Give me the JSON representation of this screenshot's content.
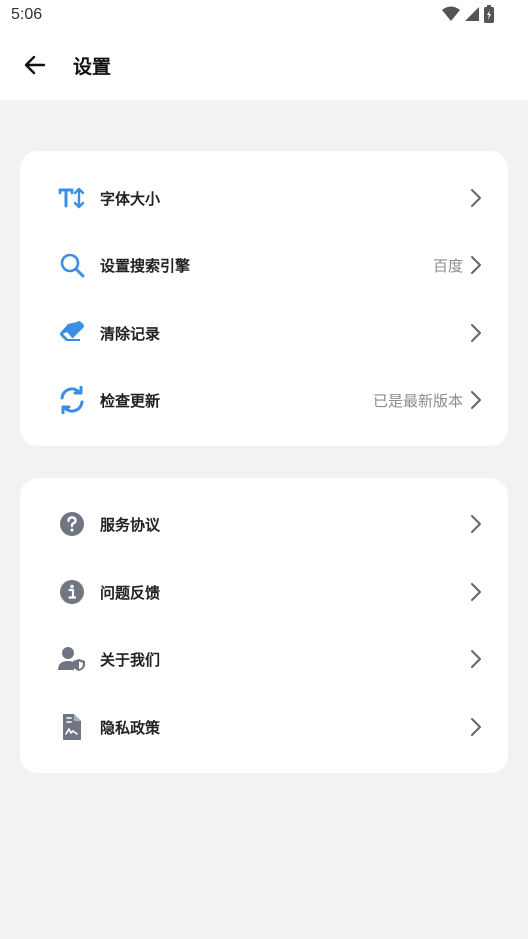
{
  "status_bar": {
    "time": "5:06",
    "icons": [
      "wifi-icon",
      "cell-signal-icon",
      "battery-icon"
    ]
  },
  "app_bar": {
    "title": "设置",
    "back_icon": "arrow-left-icon"
  },
  "colors": {
    "accent": "#3b8fe3",
    "icon_gray": "#6f7582",
    "background": "#f1f2f4"
  },
  "group1": {
    "items": [
      {
        "label": "字体大小",
        "value": "",
        "icon": "font-size-icon"
      },
      {
        "label": "设置搜索引擎",
        "value": "百度",
        "icon": "search-icon"
      },
      {
        "label": "清除记录",
        "value": "",
        "icon": "eraser-icon"
      },
      {
        "label": "检查更新",
        "value": "已是最新版本",
        "icon": "refresh-icon"
      }
    ]
  },
  "group2": {
    "items": [
      {
        "label": "服务协议",
        "value": "",
        "icon": "question-circle-icon"
      },
      {
        "label": "问题反馈",
        "value": "",
        "icon": "info-circle-icon"
      },
      {
        "label": "关于我们",
        "value": "",
        "icon": "user-shield-icon"
      },
      {
        "label": "隐私政策",
        "value": "",
        "icon": "document-icon"
      }
    ]
  }
}
